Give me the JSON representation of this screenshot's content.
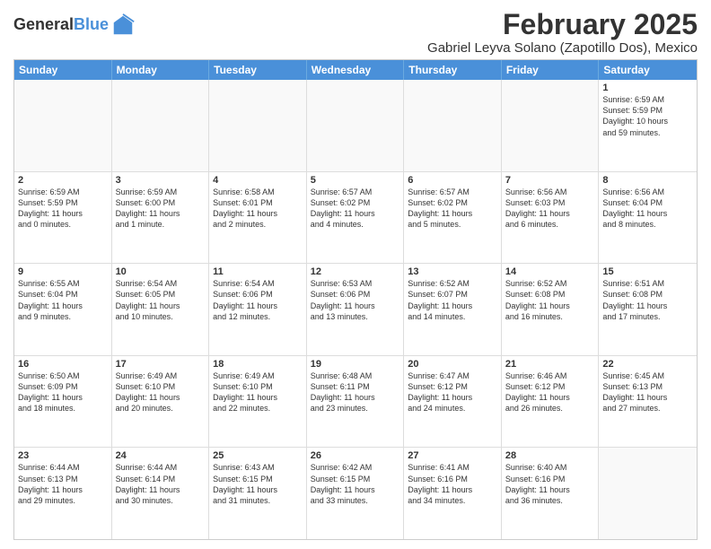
{
  "logo": {
    "line1": "General",
    "line2": "Blue"
  },
  "title": "February 2025",
  "subtitle": "Gabriel Leyva Solano (Zapotillo Dos), Mexico",
  "headers": [
    "Sunday",
    "Monday",
    "Tuesday",
    "Wednesday",
    "Thursday",
    "Friday",
    "Saturday"
  ],
  "weeks": [
    [
      {
        "day": "",
        "text": ""
      },
      {
        "day": "",
        "text": ""
      },
      {
        "day": "",
        "text": ""
      },
      {
        "day": "",
        "text": ""
      },
      {
        "day": "",
        "text": ""
      },
      {
        "day": "",
        "text": ""
      },
      {
        "day": "1",
        "text": "Sunrise: 6:59 AM\nSunset: 5:59 PM\nDaylight: 10 hours\nand 59 minutes."
      }
    ],
    [
      {
        "day": "2",
        "text": "Sunrise: 6:59 AM\nSunset: 5:59 PM\nDaylight: 11 hours\nand 0 minutes."
      },
      {
        "day": "3",
        "text": "Sunrise: 6:59 AM\nSunset: 6:00 PM\nDaylight: 11 hours\nand 1 minute."
      },
      {
        "day": "4",
        "text": "Sunrise: 6:58 AM\nSunset: 6:01 PM\nDaylight: 11 hours\nand 2 minutes."
      },
      {
        "day": "5",
        "text": "Sunrise: 6:57 AM\nSunset: 6:02 PM\nDaylight: 11 hours\nand 4 minutes."
      },
      {
        "day": "6",
        "text": "Sunrise: 6:57 AM\nSunset: 6:02 PM\nDaylight: 11 hours\nand 5 minutes."
      },
      {
        "day": "7",
        "text": "Sunrise: 6:56 AM\nSunset: 6:03 PM\nDaylight: 11 hours\nand 6 minutes."
      },
      {
        "day": "8",
        "text": "Sunrise: 6:56 AM\nSunset: 6:04 PM\nDaylight: 11 hours\nand 8 minutes."
      }
    ],
    [
      {
        "day": "9",
        "text": "Sunrise: 6:55 AM\nSunset: 6:04 PM\nDaylight: 11 hours\nand 9 minutes."
      },
      {
        "day": "10",
        "text": "Sunrise: 6:54 AM\nSunset: 6:05 PM\nDaylight: 11 hours\nand 10 minutes."
      },
      {
        "day": "11",
        "text": "Sunrise: 6:54 AM\nSunset: 6:06 PM\nDaylight: 11 hours\nand 12 minutes."
      },
      {
        "day": "12",
        "text": "Sunrise: 6:53 AM\nSunset: 6:06 PM\nDaylight: 11 hours\nand 13 minutes."
      },
      {
        "day": "13",
        "text": "Sunrise: 6:52 AM\nSunset: 6:07 PM\nDaylight: 11 hours\nand 14 minutes."
      },
      {
        "day": "14",
        "text": "Sunrise: 6:52 AM\nSunset: 6:08 PM\nDaylight: 11 hours\nand 16 minutes."
      },
      {
        "day": "15",
        "text": "Sunrise: 6:51 AM\nSunset: 6:08 PM\nDaylight: 11 hours\nand 17 minutes."
      }
    ],
    [
      {
        "day": "16",
        "text": "Sunrise: 6:50 AM\nSunset: 6:09 PM\nDaylight: 11 hours\nand 18 minutes."
      },
      {
        "day": "17",
        "text": "Sunrise: 6:49 AM\nSunset: 6:10 PM\nDaylight: 11 hours\nand 20 minutes."
      },
      {
        "day": "18",
        "text": "Sunrise: 6:49 AM\nSunset: 6:10 PM\nDaylight: 11 hours\nand 22 minutes."
      },
      {
        "day": "19",
        "text": "Sunrise: 6:48 AM\nSunset: 6:11 PM\nDaylight: 11 hours\nand 23 minutes."
      },
      {
        "day": "20",
        "text": "Sunrise: 6:47 AM\nSunset: 6:12 PM\nDaylight: 11 hours\nand 24 minutes."
      },
      {
        "day": "21",
        "text": "Sunrise: 6:46 AM\nSunset: 6:12 PM\nDaylight: 11 hours\nand 26 minutes."
      },
      {
        "day": "22",
        "text": "Sunrise: 6:45 AM\nSunset: 6:13 PM\nDaylight: 11 hours\nand 27 minutes."
      }
    ],
    [
      {
        "day": "23",
        "text": "Sunrise: 6:44 AM\nSunset: 6:13 PM\nDaylight: 11 hours\nand 29 minutes."
      },
      {
        "day": "24",
        "text": "Sunrise: 6:44 AM\nSunset: 6:14 PM\nDaylight: 11 hours\nand 30 minutes."
      },
      {
        "day": "25",
        "text": "Sunrise: 6:43 AM\nSunset: 6:15 PM\nDaylight: 11 hours\nand 31 minutes."
      },
      {
        "day": "26",
        "text": "Sunrise: 6:42 AM\nSunset: 6:15 PM\nDaylight: 11 hours\nand 33 minutes."
      },
      {
        "day": "27",
        "text": "Sunrise: 6:41 AM\nSunset: 6:16 PM\nDaylight: 11 hours\nand 34 minutes."
      },
      {
        "day": "28",
        "text": "Sunrise: 6:40 AM\nSunset: 6:16 PM\nDaylight: 11 hours\nand 36 minutes."
      },
      {
        "day": "",
        "text": ""
      }
    ]
  ]
}
